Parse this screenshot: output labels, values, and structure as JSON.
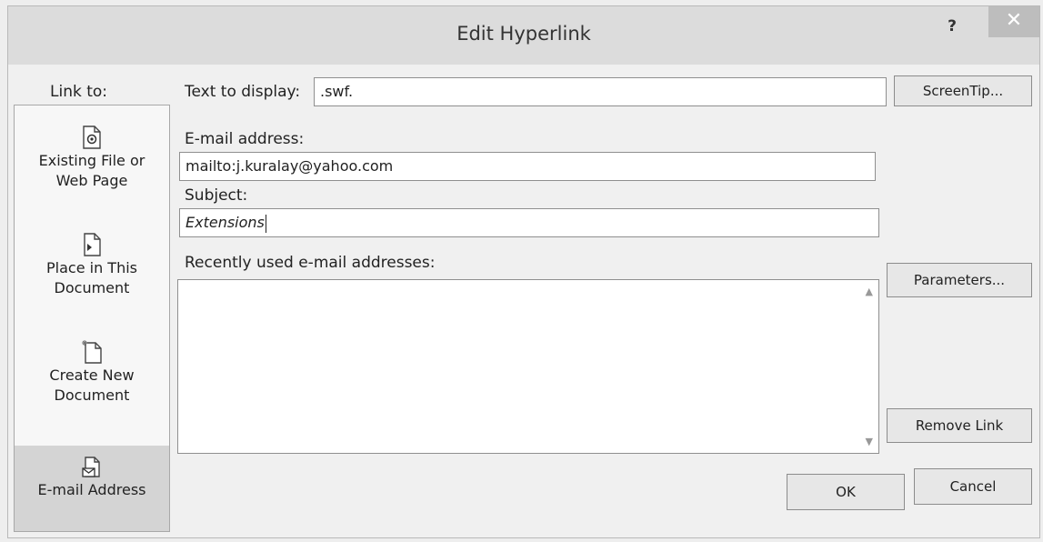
{
  "window": {
    "title": "Edit Hyperlink",
    "help_label": "?",
    "close_label": "✕"
  },
  "link_to": {
    "label": "Link to:",
    "items": [
      {
        "label_lines": [
          "Existing File or",
          "Web Page"
        ],
        "icon": "file-web-icon",
        "selected": false
      },
      {
        "label_lines": [
          "Place in This",
          "Document"
        ],
        "icon": "bookmark-place-icon",
        "selected": false
      },
      {
        "label_lines": [
          "Create New",
          "Document"
        ],
        "icon": "new-document-icon",
        "selected": false
      },
      {
        "label_lines": [
          "E-mail Address"
        ],
        "icon": "email-address-icon",
        "selected": true
      }
    ]
  },
  "text_to_display": {
    "label": "Text to display:",
    "value": ".swf."
  },
  "screentip_button": "ScreenTip...",
  "email_address": {
    "label": "E-mail address:",
    "value": "mailto:j.kuralay@yahoo.com"
  },
  "subject": {
    "label": "Subject:",
    "value": "Extensions"
  },
  "recent": {
    "label": "Recently used e-mail addresses:",
    "items": []
  },
  "parameters_button": "Parameters...",
  "remove_link_button": "Remove Link",
  "ok_button": "OK",
  "cancel_button": "Cancel"
}
